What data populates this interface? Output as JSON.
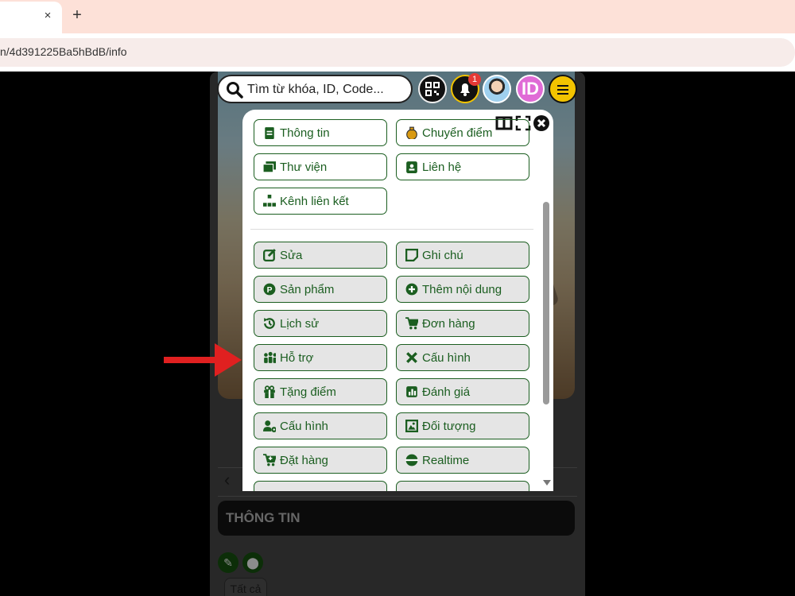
{
  "browser": {
    "tab_close": "×",
    "new_tab": "+",
    "url": "n/4d391225Ba5hBdB/info"
  },
  "header": {
    "search_placeholder": "Tìm từ khóa, ID, Code...",
    "notification_count": "1",
    "id_label": "ID"
  },
  "menu": {
    "top_items": [
      {
        "label": "Thông tin",
        "icon": "file-icon"
      },
      {
        "label": "Chuyển điểm",
        "icon": "money-bag-icon"
      },
      {
        "label": "Thư viện",
        "icon": "images-icon"
      },
      {
        "label": "Liên hệ",
        "icon": "contact-card-icon"
      },
      {
        "label": "Kênh liên kết",
        "icon": "network-icon"
      }
    ],
    "items": [
      {
        "label": "Sửa",
        "icon": "edit-icon"
      },
      {
        "label": "Ghi chú",
        "icon": "note-icon"
      },
      {
        "label": "Sản phẩm",
        "icon": "product-icon"
      },
      {
        "label": "Thêm nội dung",
        "icon": "plus-circle-icon"
      },
      {
        "label": "Lịch sử",
        "icon": "history-icon"
      },
      {
        "label": "Đơn hàng",
        "icon": "cart-icon"
      },
      {
        "label": "Hỗ trợ",
        "icon": "people-icon"
      },
      {
        "label": "Cấu hình",
        "icon": "tools-icon"
      },
      {
        "label": "Tặng điểm",
        "icon": "gift-icon"
      },
      {
        "label": "Đánh giá",
        "icon": "chart-icon"
      },
      {
        "label": "Cấu hình",
        "icon": "user-gear-icon"
      },
      {
        "label": "Đối tượng",
        "icon": "image-box-icon"
      },
      {
        "label": "Đặt hàng",
        "icon": "cart-plus-icon"
      },
      {
        "label": "Realtime",
        "icon": "realtime-icon"
      }
    ]
  },
  "page": {
    "back": "‹",
    "section_title": "THÔNG TIN",
    "filter_all": "Tất cả"
  },
  "colors": {
    "accent_green": "#1b5e20",
    "bell_ring": "#f2c300",
    "badge_red": "#e53935",
    "id_pink": "#e06bd6",
    "arrow_red": "#e02020"
  }
}
